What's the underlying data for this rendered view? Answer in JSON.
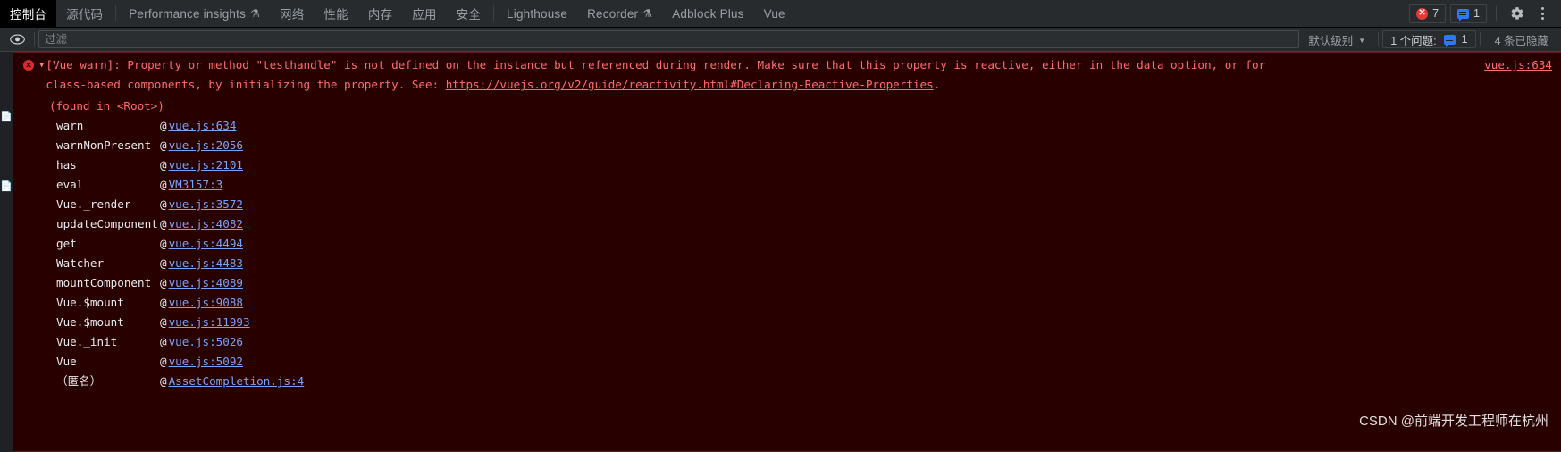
{
  "tabs": [
    {
      "label": "控制台",
      "active": true,
      "flask": false
    },
    {
      "label": "源代码",
      "active": false,
      "flask": false
    },
    {
      "label": "Performance insights",
      "active": false,
      "flask": true
    },
    {
      "label": "网络",
      "active": false,
      "flask": false
    },
    {
      "label": "性能",
      "active": false,
      "flask": false
    },
    {
      "label": "内存",
      "active": false,
      "flask": false
    },
    {
      "label": "应用",
      "active": false,
      "flask": false
    },
    {
      "label": "安全",
      "active": false,
      "flask": false
    },
    {
      "label": "Lighthouse",
      "active": false,
      "flask": false
    },
    {
      "label": "Recorder",
      "active": false,
      "flask": true
    },
    {
      "label": "Adblock Plus",
      "active": false,
      "flask": false
    },
    {
      "label": "Vue",
      "active": false,
      "flask": false
    }
  ],
  "toolbar": {
    "error_count": "7",
    "message_count": "1",
    "error_mark": "✕",
    "settings_icon": "gear-icon",
    "more_icon": "kebab-menu-icon"
  },
  "filterbar": {
    "eye_icon": "eye-icon",
    "filter_placeholder": "过滤",
    "filter_value": "",
    "level_label": "默认级别",
    "level_caret": "▼",
    "issues_label": "1 个问题:",
    "issues_count": "1",
    "hidden_label": "4 条已隐藏"
  },
  "console": {
    "entry": {
      "icon": "error-circle-icon",
      "expander": "▼",
      "text_before_link": "[Vue warn]: Property or method \"testhandle\" is not defined on the instance but referenced during render. Make sure that this property is reactive, either in the data option, or for class-based components, by initializing the property. See: ",
      "link_text": "https://vuejs.org/v2/guide/reactivity.html#Declaring-Reactive-Properties",
      "text_after_link": ".",
      "source_link": "vue.js:634",
      "found_in": "(found in <Root>)"
    },
    "stack": [
      {
        "fn": "warn",
        "at": "@",
        "link": "vue.js:634"
      },
      {
        "fn": "warnNonPresent",
        "at": "@",
        "link": "vue.js:2056"
      },
      {
        "fn": "has",
        "at": "@",
        "link": "vue.js:2101"
      },
      {
        "fn": "eval",
        "at": "@",
        "link": "VM3157:3"
      },
      {
        "fn": "Vue._render",
        "at": "@",
        "link": "vue.js:3572"
      },
      {
        "fn": "updateComponent",
        "at": "@",
        "link": "vue.js:4082"
      },
      {
        "fn": "get",
        "at": "@",
        "link": "vue.js:4494"
      },
      {
        "fn": "Watcher",
        "at": "@",
        "link": "vue.js:4483"
      },
      {
        "fn": "mountComponent",
        "at": "@",
        "link": "vue.js:4089"
      },
      {
        "fn": "Vue.$mount",
        "at": "@",
        "link": "vue.js:9088"
      },
      {
        "fn": "Vue.$mount",
        "at": "@",
        "link": "vue.js:11993"
      },
      {
        "fn": "Vue._init",
        "at": "@",
        "link": "vue.js:5026"
      },
      {
        "fn": "Vue",
        "at": "@",
        "link": "vue.js:5092"
      },
      {
        "fn": "（匿名）",
        "at": "@",
        "link": "AssetCompletion.js:4"
      }
    ]
  },
  "watermark": "CSDN @前端开发工程师在杭州"
}
